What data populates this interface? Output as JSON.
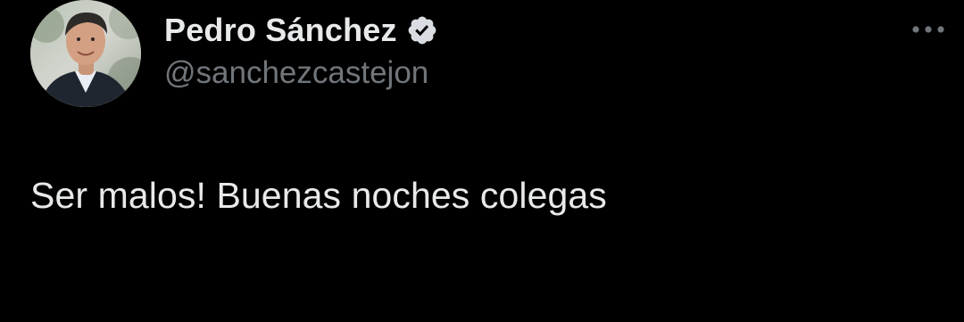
{
  "author": {
    "display_name": "Pedro Sánchez",
    "handle": "@sanchezcastejon",
    "verified": true,
    "avatar_icon": "profile-photo"
  },
  "tweet": {
    "text": "Ser malos! Buenas noches colegas"
  },
  "more_icon": "more-horizontal-icon",
  "colors": {
    "background": "#000000",
    "primary_text": "#e7e9ea",
    "secondary_text": "#71767b",
    "verified_badge": "#d9dde1"
  }
}
